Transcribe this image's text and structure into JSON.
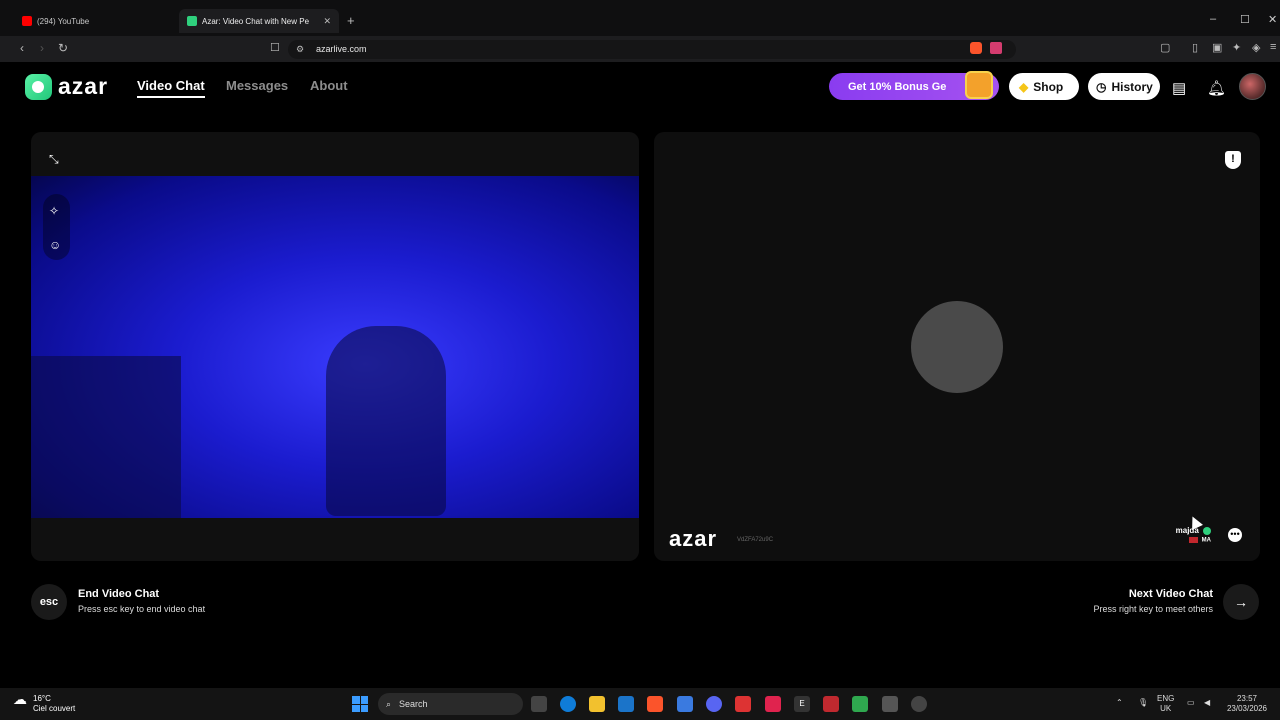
{
  "browser": {
    "tabs": [
      {
        "title": "(294) YouTube",
        "favicon_color": "#ff0000"
      },
      {
        "title": "Azar: Video Chat with New Pe",
        "favicon_color": "#2fd07d"
      }
    ],
    "new_tab": "+",
    "url": "azarlive.com",
    "window_controls": [
      "–",
      "☐",
      "✕"
    ]
  },
  "site": {
    "logo_text": "azar",
    "nav": [
      {
        "label": "Video Chat",
        "active": true
      },
      {
        "label": "Messages",
        "active": false
      },
      {
        "label": "About",
        "active": false
      }
    ],
    "promo_label": "Get 10% Bonus Ge",
    "shop_label": "Shop",
    "history_label": "History"
  },
  "remote_panel": {
    "logo_text": "azar",
    "session_id": "VdZFA72u9C",
    "username": "majda",
    "country": "MA",
    "shield_glyph": "!"
  },
  "controls": {
    "esc_label": "esc",
    "end_title": "End Video Chat",
    "end_subtitle": "Press esc key to end video chat",
    "next_title": "Next Video Chat",
    "next_subtitle": "Press right key to meet others",
    "next_arrow": "→"
  },
  "taskbar": {
    "temperature": "16°C",
    "weather_desc": "Ciel couvert",
    "search_placeholder": "Search",
    "language": "ENG",
    "region": "UK",
    "time": "23:57",
    "date": "23/03/2026"
  },
  "colors": {
    "accent_purple": "#8a3cf0",
    "brand_green": "#2fd07d",
    "video_blue": "#1b1ccf"
  }
}
